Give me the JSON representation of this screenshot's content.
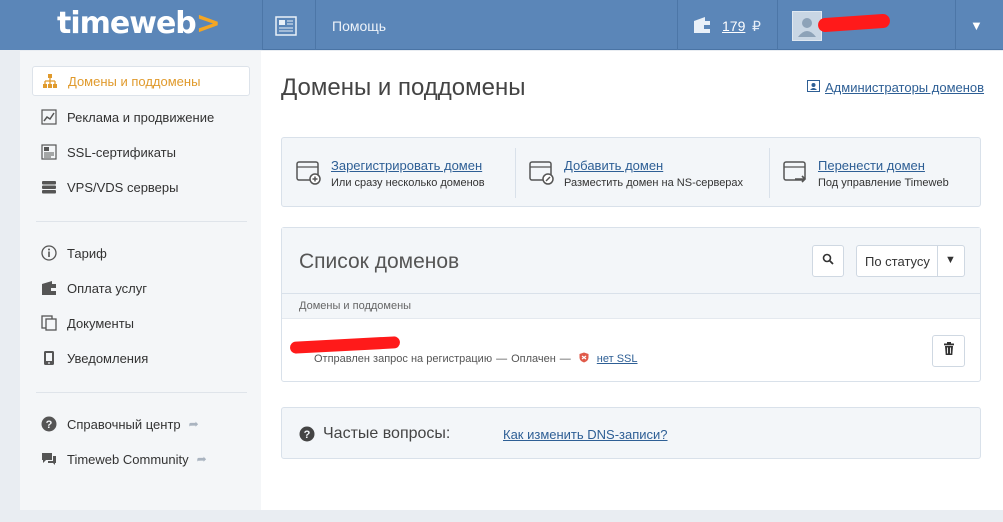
{
  "topbar": {
    "logo_text": "timeweb",
    "logo_arrow": ">",
    "help_label": "Помощь",
    "balance": "179",
    "currency": "₽",
    "caret": "▼"
  },
  "sidebar": {
    "items": [
      {
        "label": "Домены и поддомены",
        "icon": "sitemap-icon"
      },
      {
        "label": "Реклама и продвижение",
        "icon": "chart-icon"
      },
      {
        "label": "SSL-сертификаты",
        "icon": "certificate-icon"
      },
      {
        "label": "VPS/VDS серверы",
        "icon": "server-icon"
      },
      {
        "label": "Тариф",
        "icon": "info-icon"
      },
      {
        "label": "Оплата услуг",
        "icon": "wallet-icon"
      },
      {
        "label": "Документы",
        "icon": "documents-icon"
      },
      {
        "label": "Уведомления",
        "icon": "phone-icon"
      },
      {
        "label": "Справочный центр",
        "icon": "question-icon"
      },
      {
        "label": "Timeweb Community",
        "icon": "chat-icon"
      }
    ],
    "ext_arrow": "➦"
  },
  "main": {
    "title": "Домены и поддомены",
    "admins_link": "Администраторы доменов",
    "actions": [
      {
        "title": "Зарегистрировать домен",
        "subtitle": "Или сразу несколько доменов"
      },
      {
        "title": "Добавить домен",
        "subtitle": "Разместить домен на NS-серверах"
      },
      {
        "title": "Перенести домен",
        "subtitle": "Под управление Timeweb"
      }
    ],
    "list": {
      "title": "Список доменов",
      "status_filter": "По статусу",
      "column_header": "Домены и поддомены",
      "row": {
        "status_request": "Отправлен запрос на регистрацию",
        "sep": "—",
        "status_paid": "Оплачен",
        "ssl": "нет SSL"
      }
    },
    "faq": {
      "title": "Частые вопросы:",
      "link": "Как изменить DNS-записи?"
    }
  },
  "colors": {
    "topbar": "#5b86b8",
    "accent": "#e09a2c",
    "link": "#2e5f95"
  }
}
